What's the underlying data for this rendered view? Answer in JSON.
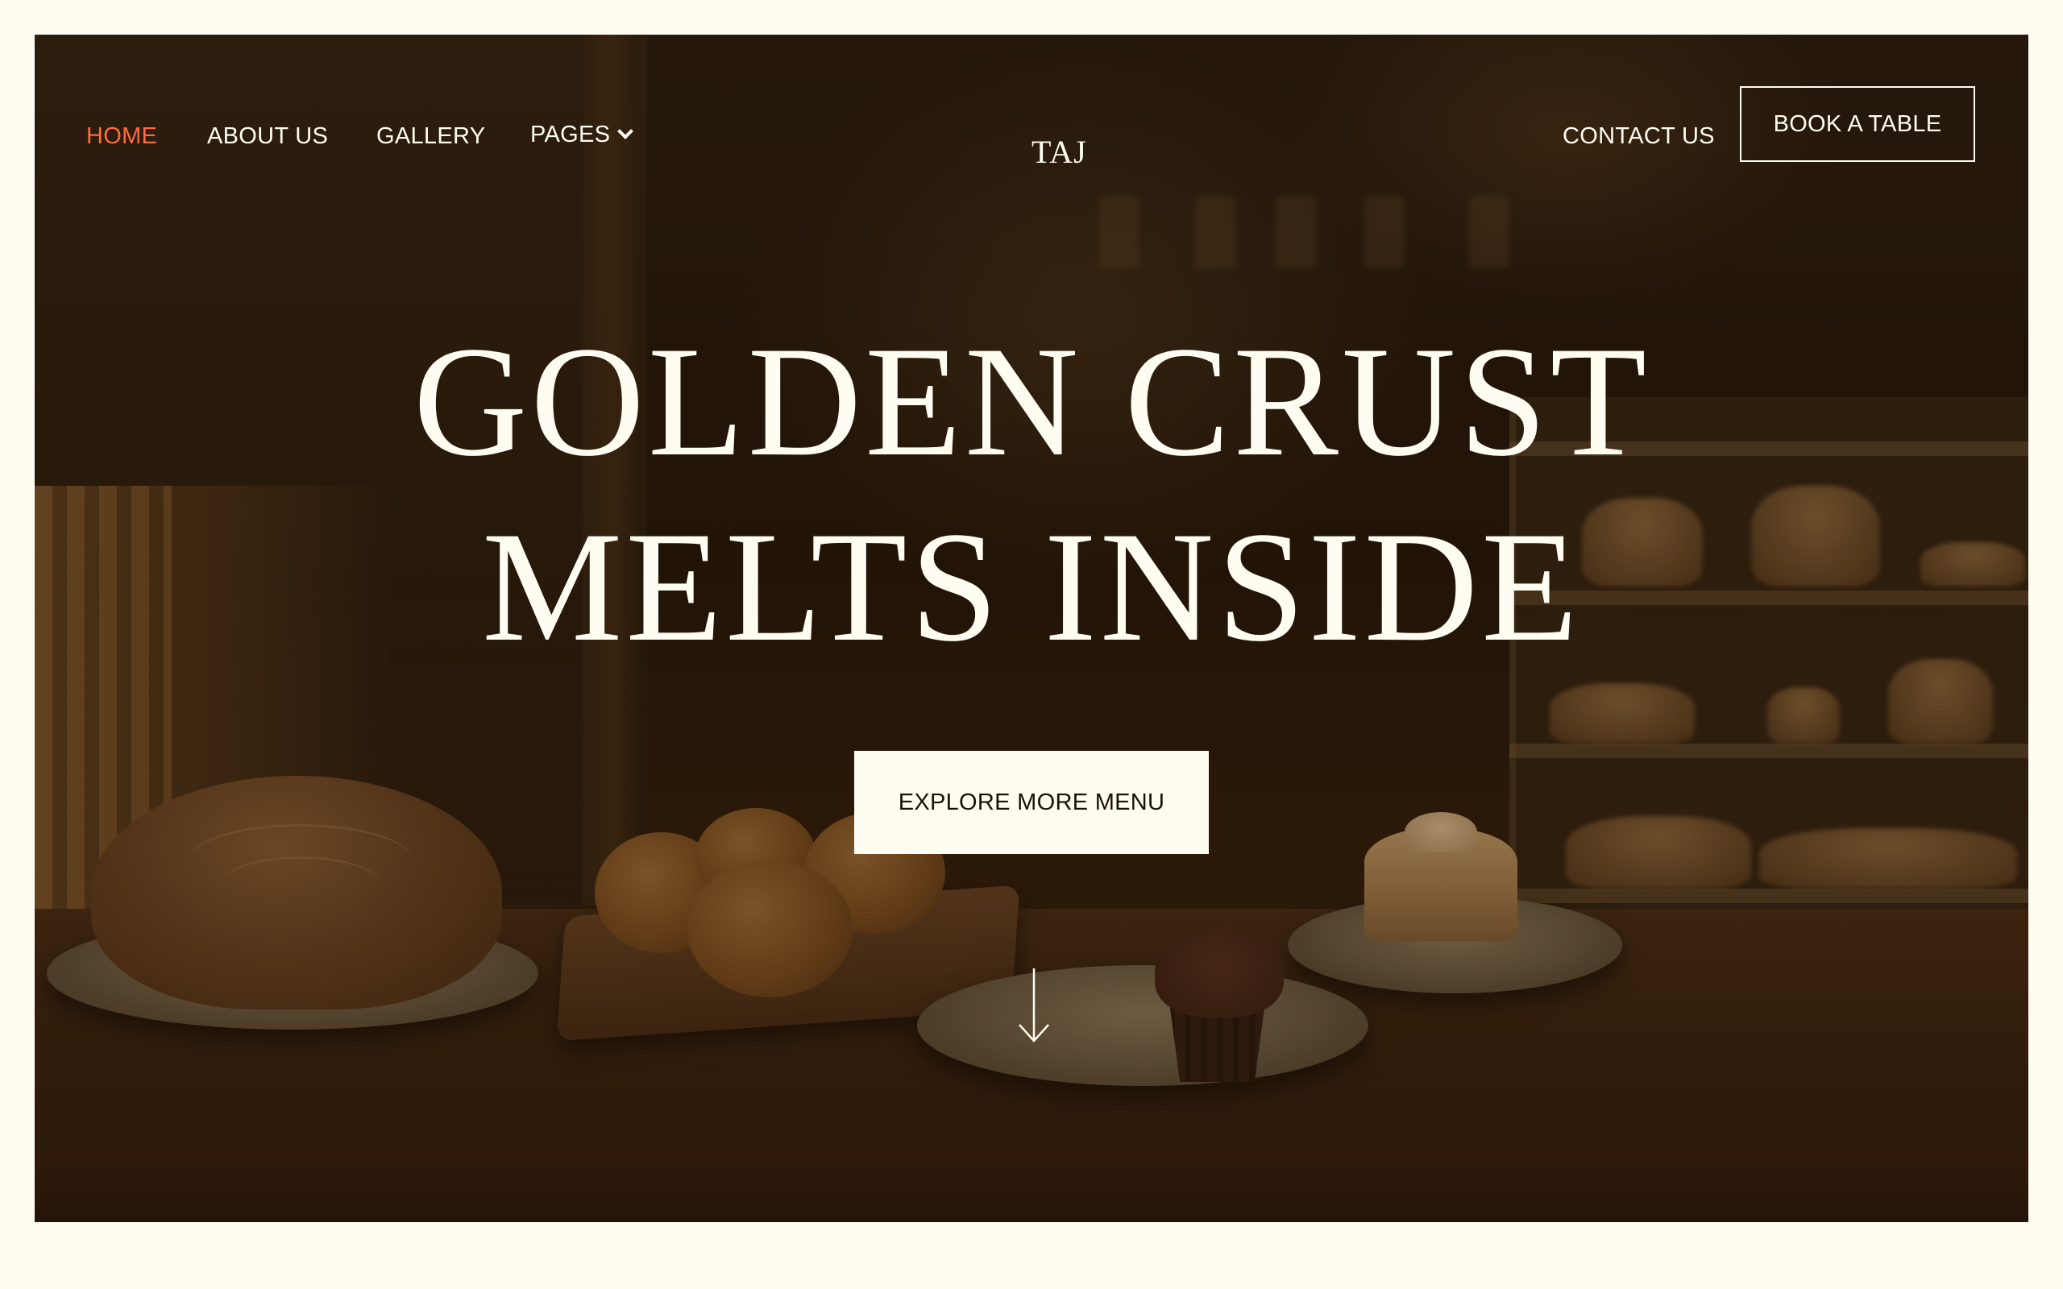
{
  "nav": {
    "left_items": [
      {
        "label": "HOME",
        "active": true
      },
      {
        "label": "ABOUT US",
        "active": false
      },
      {
        "label": "GALLERY",
        "active": false
      },
      {
        "label": "PAGES",
        "active": false,
        "has_dropdown": true
      }
    ],
    "logo": "TAJ",
    "contact_label": "CONTACT US",
    "book_label": "BOOK A TABLE"
  },
  "hero": {
    "headline_line1": "GOLDEN CRUST",
    "headline_line2": "MELTS INSIDE",
    "cta_label": "EXPLORE MORE MENU",
    "scroll_icon": "arrow-down-icon"
  },
  "colors": {
    "page_background": "#fffdf2",
    "active_nav": "#ff6a3d",
    "text_light": "#fffdf2",
    "cta_background": "#fffdf2",
    "cta_text": "#1a120a"
  }
}
